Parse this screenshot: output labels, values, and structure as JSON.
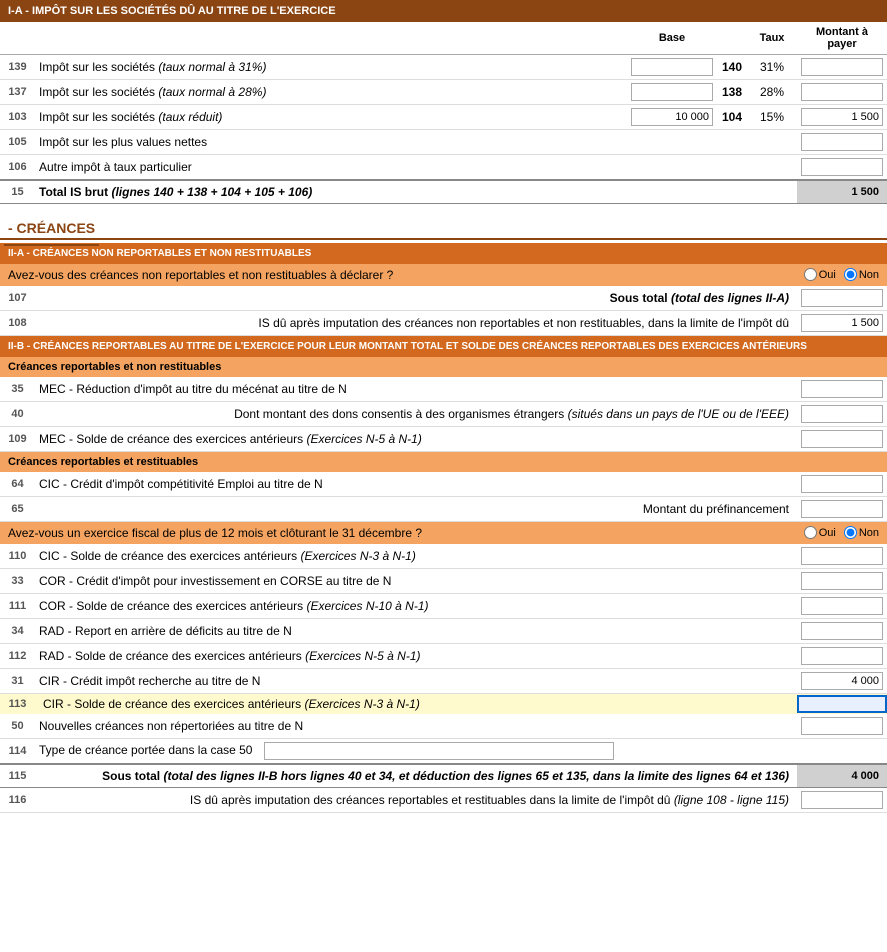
{
  "sections": {
    "impot": {
      "title": "I-A - IMPÔT SUR LES SOCIÉTÉS DÛ AU TITRE DE L'EXERCICE",
      "header": {
        "base": "Base",
        "taux": "Taux",
        "montant": "Montant à payer"
      },
      "rows": [
        {
          "num": "139",
          "label": "Impôt sur les sociétés ",
          "label_italic": "(taux normal à 31%)",
          "ref": "140",
          "taux": "31%",
          "base_value": "",
          "montant_value": ""
        },
        {
          "num": "137",
          "label": "Impôt sur les sociétés ",
          "label_italic": "(taux normal à 28%)",
          "ref": "138",
          "taux": "28%",
          "base_value": "",
          "montant_value": ""
        },
        {
          "num": "103",
          "label": "Impôt sur les sociétés ",
          "label_italic": "(taux réduit)",
          "ref": "104",
          "taux": "15%",
          "base_value": "10 000",
          "montant_value": "1 500"
        },
        {
          "num": "105",
          "label": "Impôt sur les plus values nettes",
          "label_italic": "",
          "ref": "",
          "taux": "",
          "base_value": "",
          "montant_value": ""
        },
        {
          "num": "106",
          "label": "Autre impôt à taux particulier",
          "label_italic": "",
          "ref": "",
          "taux": "",
          "base_value": "",
          "montant_value": ""
        }
      ],
      "total": {
        "num": "15",
        "label": "Total IS brut ",
        "label_italic": "(lignes 140 + 138 + 104 + 105 + 106)",
        "value": "1 500"
      }
    },
    "creances_title": "- CRÉANCES",
    "creances_nr": {
      "title": "II-A - CRÉANCES NON REPORTABLES ET NON RESTITUABLES",
      "question": "Avez-vous des créances non reportables et non restituables à déclarer ?",
      "oui": "Oui",
      "non": "Non",
      "rows": [
        {
          "num": "107",
          "label": "Sous total ",
          "label_italic": "(total des lignes II-A)",
          "value": "",
          "align": "right"
        },
        {
          "num": "108",
          "label": "IS dû après imputation des créances non reportables et non restituables, dans la limite de l'impôt dû",
          "value": "1 500",
          "align": "right"
        }
      ]
    },
    "creances_r": {
      "title": "II-B - CRÉANCES REPORTABLES AU TITRE DE L'EXERCICE POUR LEUR MONTANT TOTAL ET SOLDE DES CRÉANCES REPORTABLES DES EXERCICES ANTÉRIEURS",
      "subsection1": {
        "title": "Créances reportables et non restituables",
        "rows": [
          {
            "num": "35",
            "label": "MEC - Réduction d'impôt au titre du mécénat au titre de N",
            "value": ""
          },
          {
            "num": "40",
            "label": "Dont montant des dons consentis à des organismes étrangers ",
            "label_italic": "(situés dans un pays de l'UE ou de l'EEE)",
            "value": "",
            "align": "right"
          },
          {
            "num": "109",
            "label": "MEC - Solde de créance des exercices antérieurs ",
            "label_italic": "(Exercices N-5 à N-1)",
            "value": ""
          }
        ]
      },
      "subsection2": {
        "title": "Créances reportables et restituables",
        "rows": [
          {
            "num": "64",
            "label": "CIC - Crédit d'impôt compétitivité Emploi au titre de N",
            "value": ""
          },
          {
            "num": "65",
            "label": "Montant du préfinancement",
            "value": "",
            "align": "right"
          }
        ]
      },
      "question": "Avez-vous un exercice fiscal de plus de 12 mois et clôturant le 31 décembre ?",
      "oui": "Oui",
      "non": "Non",
      "rows2": [
        {
          "num": "110",
          "label": "CIC - Solde de créance des exercices antérieurs ",
          "label_italic": "(Exercices N-3 à N-1)",
          "value": ""
        },
        {
          "num": "33",
          "label": "COR - Crédit d'impôt pour investissement en CORSE au titre de N",
          "value": ""
        },
        {
          "num": "111",
          "label": "COR - Solde de créance des exercices antérieurs ",
          "label_italic": "(Exercices N-10 à N-1)",
          "value": ""
        },
        {
          "num": "34",
          "label": "RAD - Report en arrière de déficits au titre de N",
          "value": ""
        },
        {
          "num": "112",
          "label": "RAD - Solde de créance des exercices antérieurs ",
          "label_italic": "(Exercices N-5 à N-1)",
          "value": ""
        },
        {
          "num": "31",
          "label": "CIR - Crédit impôt recherche au titre de N",
          "value": "4 000"
        },
        {
          "num": "113",
          "label": "CIR - Solde de créance des exercices antérieurs ",
          "label_italic": "(Exercices N-3 à N-1)",
          "value": "",
          "highlighted": true,
          "active_input": true
        },
        {
          "num": "50",
          "label": "Nouvelles créances non répertoriées au titre de N",
          "value": ""
        },
        {
          "num": "114",
          "label": "Type de créance portée dans la case 50",
          "value": "",
          "text_input": true
        }
      ],
      "total_row": {
        "num": "115",
        "label": "Sous total ",
        "label_italic": "(total des lignes II-B hors lignes 40 et 34, et déduction des lignes 65 et 135, dans la limite des lignes 64 et 136)",
        "value": "4 000",
        "align": "right"
      },
      "last_row": {
        "num": "116",
        "label": "IS dû après imputation des créances reportables et restituables dans la limite de l'impôt dû ",
        "label_italic": "(ligne 108 - ligne 115)",
        "value": "",
        "align": "right"
      }
    }
  }
}
